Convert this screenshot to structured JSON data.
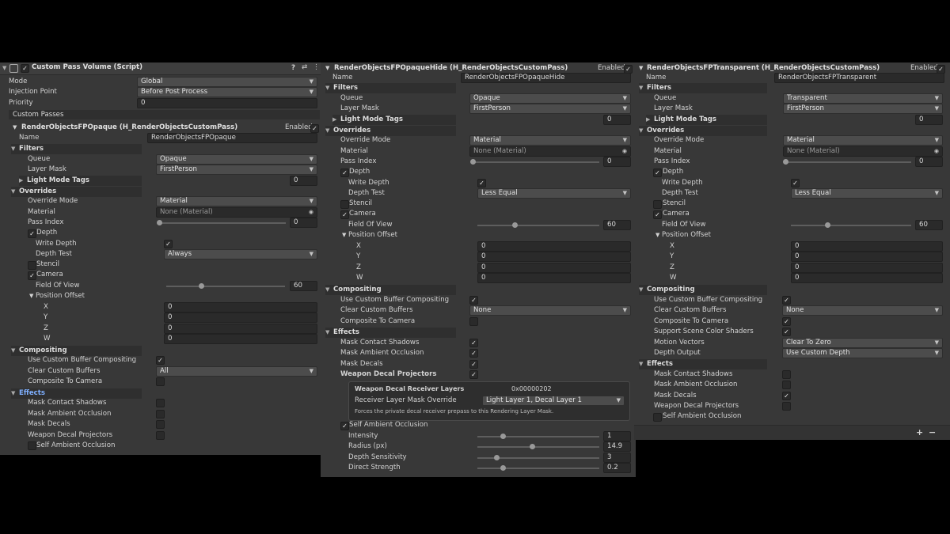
{
  "panel1": {
    "title": "Custom Pass Volume (Script)",
    "mode_label": "Mode",
    "mode_value": "Global",
    "injection_label": "Injection Point",
    "injection_value": "Before Post Process",
    "priority_label": "Priority",
    "priority_value": "0",
    "custom_passes_label": "Custom Passes",
    "pass_title": "RenderObjectsFPOpaque (H_RenderObjectsCustomPass)",
    "enabled_label": "Enabled",
    "name_label": "Name",
    "name_value": "RenderObjectsFPOpaque",
    "filters_label": "Filters",
    "queue_label": "Queue",
    "queue_value": "Opaque",
    "layer_mask_label": "Layer Mask",
    "layer_mask_value": "FirstPerson",
    "light_mode_tags_label": "Light Mode Tags",
    "light_mode_tags_value": "0",
    "overrides_label": "Overrides",
    "override_mode_label": "Override Mode",
    "override_mode_value": "Material",
    "material_label": "Material",
    "material_value": "None (Material)",
    "pass_index_label": "Pass Index",
    "pass_index_value": "0",
    "depth_label": "Depth",
    "write_depth_label": "Write Depth",
    "depth_test_label": "Depth Test",
    "depth_test_value": "Always",
    "stencil_label": "Stencil",
    "camera_label": "Camera",
    "fov_label": "Field Of View",
    "fov_value": "60",
    "position_offset_label": "Position Offset",
    "x_label": "X",
    "x_value": "0",
    "y_label": "Y",
    "y_value": "0",
    "z_label": "Z",
    "z_value": "0",
    "w_label": "W",
    "w_value": "0",
    "compositing_label": "Compositing",
    "use_custom_buffer_label": "Use Custom Buffer Compositing",
    "clear_custom_buffers_label": "Clear Custom Buffers",
    "clear_custom_buffers_value": "All",
    "composite_to_camera_label": "Composite To Camera",
    "effects_label": "Effects",
    "mask_contact_shadows_label": "Mask Contact Shadows",
    "mask_ambient_occlusion_label": "Mask Ambient Occlusion",
    "mask_decals_label": "Mask Decals",
    "weapon_decal_projectors_label": "Weapon Decal Projectors",
    "self_ambient_occlusion_label": "Self Ambient Occlusion"
  },
  "panel2": {
    "pass_title": "RenderObjectsFPOpaqueHide (H_RenderObjectsCustomPass)",
    "enabled_label": "Enabled",
    "name_label": "Name",
    "name_value": "RenderObjectsFPOpaqueHide",
    "filters_label": "Filters",
    "queue_label": "Queue",
    "queue_value": "Opaque",
    "layer_mask_label": "Layer Mask",
    "layer_mask_value": "FirstPerson",
    "light_mode_tags_label": "Light Mode Tags",
    "light_mode_tags_value": "0",
    "overrides_label": "Overrides",
    "override_mode_label": "Override Mode",
    "override_mode_value": "Material",
    "material_label": "Material",
    "material_value": "None (Material)",
    "pass_index_label": "Pass Index",
    "pass_index_value": "0",
    "depth_label": "Depth",
    "write_depth_label": "Write Depth",
    "depth_test_label": "Depth Test",
    "depth_test_value": "Less Equal",
    "stencil_label": "Stencil",
    "camera_label": "Camera",
    "fov_label": "Field Of View",
    "fov_value": "60",
    "position_offset_label": "Position Offset",
    "x_label": "X",
    "x_value": "0",
    "y_label": "Y",
    "y_value": "0",
    "z_label": "Z",
    "z_value": "0",
    "w_label": "W",
    "w_value": "0",
    "compositing_label": "Compositing",
    "use_custom_buffer_label": "Use Custom Buffer Compositing",
    "clear_custom_buffers_label": "Clear Custom Buffers",
    "clear_custom_buffers_value": "None",
    "composite_to_camera_label": "Composite To Camera",
    "effects_label": "Effects",
    "mask_contact_shadows_label": "Mask Contact Shadows",
    "mask_ambient_occlusion_label": "Mask Ambient Occlusion",
    "mask_decals_label": "Mask Decals",
    "weapon_decal_projectors_label": "Weapon Decal Projectors",
    "receiver_layers_label": "Weapon Decal Receiver Layers",
    "receiver_layers_value": "0x00000202",
    "receiver_override_label": "Receiver Layer Mask Override",
    "receiver_override_value": "Light Layer 1, Decal Layer 1",
    "receiver_note": "Forces the private decal receiver prepass to this Rendering Layer Mask.",
    "self_ao_label": "Self Ambient Occlusion",
    "intensity_label": "Intensity",
    "intensity_value": "1",
    "radius_label": "Radius (px)",
    "radius_value": "14.9",
    "depth_sensitivity_label": "Depth Sensitivity",
    "depth_sensitivity_value": "3",
    "direct_strength_label": "Direct Strength",
    "direct_strength_value": "0.2"
  },
  "panel3": {
    "pass_title": "RenderObjectsFPTransparent (H_RenderObjectsCustomPass)",
    "enabled_label": "Enabled",
    "name_label": "Name",
    "name_value": "RenderObjectsFPTransparent",
    "filters_label": "Filters",
    "queue_label": "Queue",
    "queue_value": "Transparent",
    "layer_mask_label": "Layer Mask",
    "layer_mask_value": "FirstPerson",
    "light_mode_tags_label": "Light Mode Tags",
    "light_mode_tags_value": "0",
    "overrides_label": "Overrides",
    "override_mode_label": "Override Mode",
    "override_mode_value": "Material",
    "material_label": "Material",
    "material_value": "None (Material)",
    "pass_index_label": "Pass Index",
    "pass_index_value": "0",
    "depth_label": "Depth",
    "write_depth_label": "Write Depth",
    "depth_test_label": "Depth Test",
    "depth_test_value": "Less Equal",
    "stencil_label": "Stencil",
    "camera_label": "Camera",
    "fov_label": "Field Of View",
    "fov_value": "60",
    "position_offset_label": "Position Offset",
    "x_label": "X",
    "x_value": "0",
    "y_label": "Y",
    "y_value": "0",
    "z_label": "Z",
    "z_value": "0",
    "w_label": "W",
    "w_value": "0",
    "compositing_label": "Compositing",
    "use_custom_buffer_label": "Use Custom Buffer Compositing",
    "clear_custom_buffers_label": "Clear Custom Buffers",
    "clear_custom_buffers_value": "None",
    "composite_to_camera_label": "Composite To Camera",
    "support_scene_color_label": "Support Scene Color Shaders",
    "motion_vectors_label": "Motion Vectors",
    "motion_vectors_value": "Clear To Zero",
    "depth_output_label": "Depth Output",
    "depth_output_value": "Use Custom Depth",
    "effects_label": "Effects",
    "mask_contact_shadows_label": "Mask Contact Shadows",
    "mask_ambient_occlusion_label": "Mask Ambient Occlusion",
    "mask_decals_label": "Mask Decals",
    "weapon_decal_projectors_label": "Weapon Decal Projectors",
    "self_ambient_occlusion_label": "Self Ambient Occlusion",
    "add_label": "+",
    "remove_label": "−"
  },
  "icons": {
    "check": "✓",
    "dropdown": "▼",
    "collapse": "▼",
    "expand": "▶",
    "target": "◉",
    "help": "?",
    "settings": "⇄",
    "menu": "⋮"
  },
  "colors": {
    "panel_bg": "#383838",
    "header_bg": "#2f2f2f",
    "field_bg": "#2a2a2a",
    "dropdown_bg": "#4c4c4c",
    "effects_highlight": "#7fb0ff"
  }
}
